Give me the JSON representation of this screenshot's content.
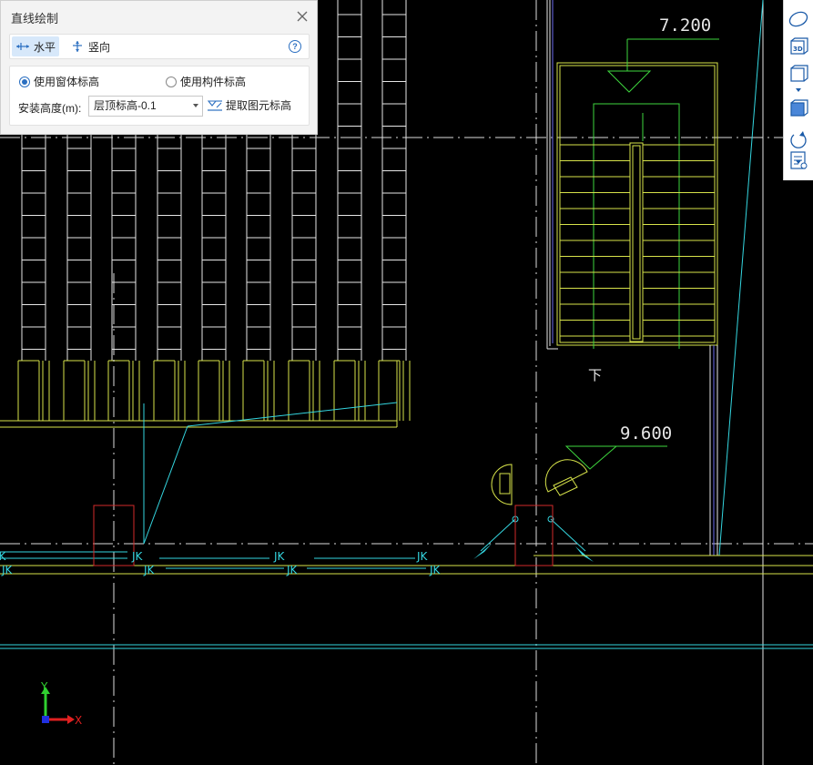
{
  "dialog": {
    "title": "直线绘制",
    "modes": {
      "horizontal": "水平",
      "vertical": "竖向"
    },
    "help": "?",
    "options": {
      "use_window_elevation": "使用窗体标高",
      "use_component_elevation": "使用构件标高",
      "selected": "use_window_elevation"
    },
    "install_height_label": "安装高度(m):",
    "install_height_value": "层顶标高-0.1",
    "extract_label": "提取图元标高"
  },
  "right_toolbar": {
    "items": [
      "perspective-view-icon",
      "3d-view-icon",
      "cube-view-icon",
      "cube-blue-view-icon",
      "rotate-icon",
      "display-settings-icon"
    ],
    "label_3d": "3D"
  },
  "drawing": {
    "elevation_top": "7.200",
    "elevation_mid": "9.600",
    "stair_label": "下",
    "jk_label": "JK",
    "axis_x": "X",
    "axis_y": "Y"
  },
  "colors": {
    "background": "#000000",
    "yellow_line": "#d7e34a",
    "green_line": "#3ed63e",
    "cyan_line": "#34d6e0",
    "white_line": "#e6e6e6",
    "red_line": "#d22a2a",
    "accent_blue": "#2b6fc1"
  }
}
